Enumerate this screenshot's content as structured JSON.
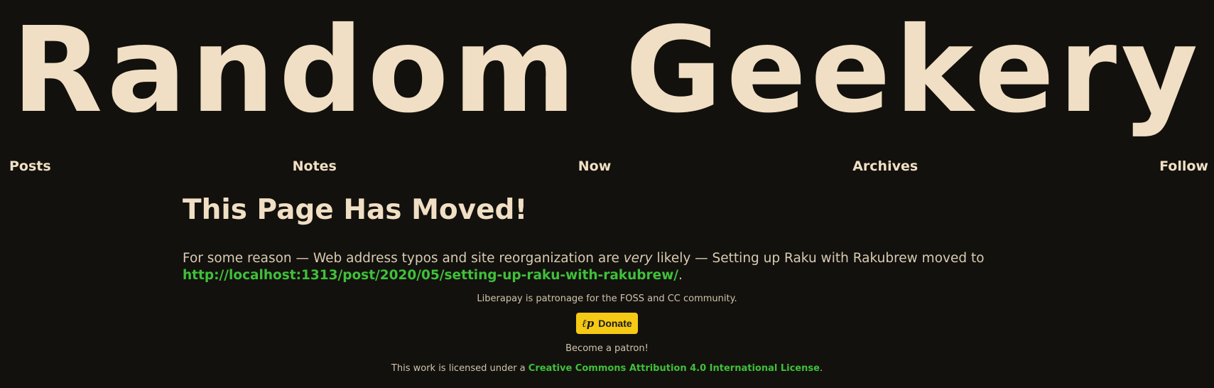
{
  "site": {
    "title": "Random Geekery"
  },
  "nav": {
    "items": [
      {
        "label": "Posts"
      },
      {
        "label": "Notes"
      },
      {
        "label": "Now"
      },
      {
        "label": "Archives"
      },
      {
        "label": "Follow"
      }
    ]
  },
  "main": {
    "headline": "This Page Has Moved!",
    "text_before": "For some reason — Web address typos and site reorganization are ",
    "emphasis": "very",
    "text_middle": " likely — Setting up Raku with Rakubrew moved to ",
    "link": "http://localhost:1313/post/2020/05/setting-up-raku-with-rakubrew/",
    "text_after": "."
  },
  "footer": {
    "liberapay_text": "Liberapay is patronage for the FOSS and CC community.",
    "donate_icon": "ℓp",
    "donate_label": "Donate",
    "patron_text": "Become a patron!",
    "license_prefix": "This work is licensed under a ",
    "license_link": "Creative Commons Attribution 4.0 International License",
    "license_suffix": "."
  },
  "colors": {
    "background": "#13110d",
    "text": "#f0dfc4",
    "link": "#3fc03a",
    "donate_button": "#f6c915"
  }
}
